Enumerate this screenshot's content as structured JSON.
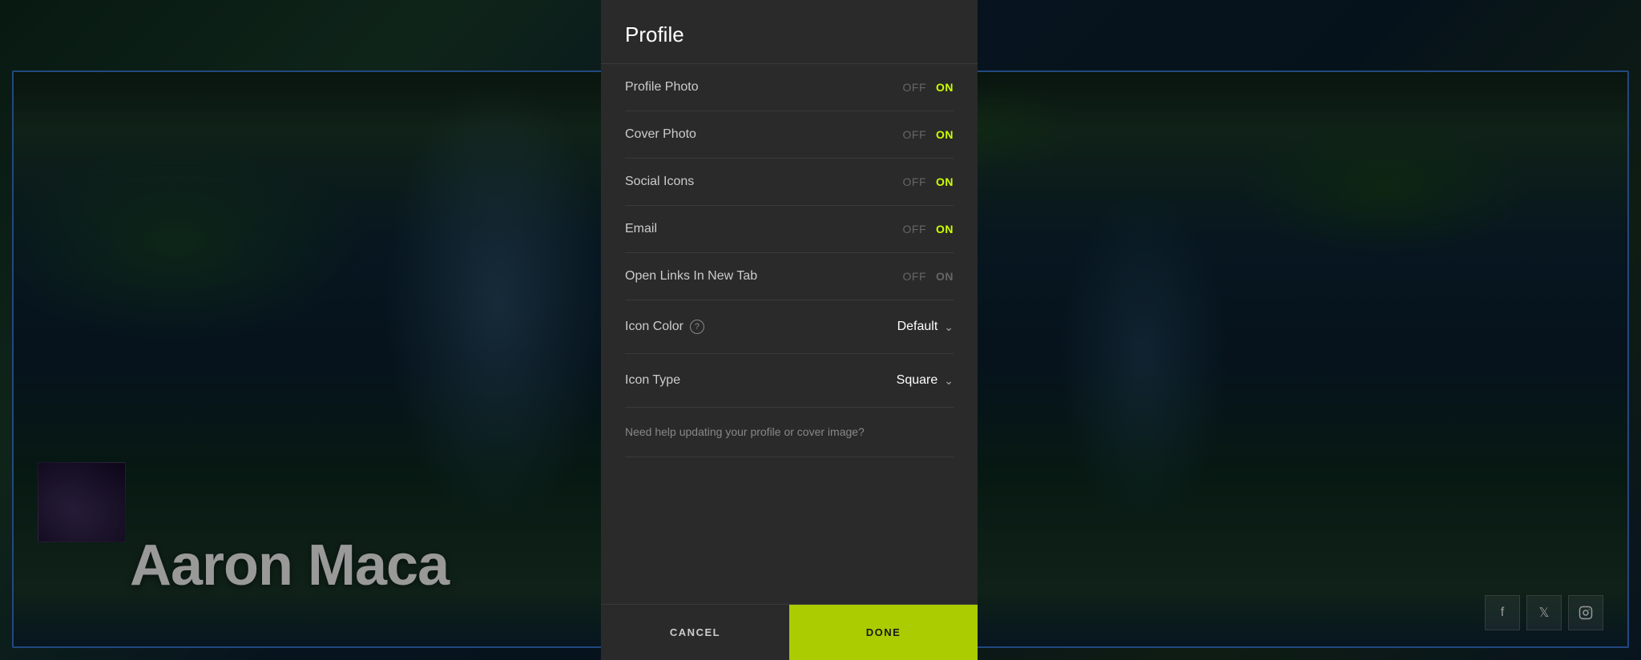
{
  "modal": {
    "title": "Profile",
    "settings": [
      {
        "id": "profile-photo",
        "label": "Profile Photo",
        "off_label": "OFF",
        "on_label": "ON",
        "value": true
      },
      {
        "id": "cover-photo",
        "label": "Cover Photo",
        "off_label": "OFF",
        "on_label": "ON",
        "value": true
      },
      {
        "id": "social-icons",
        "label": "Social Icons",
        "off_label": "OFF",
        "on_label": "ON",
        "value": true
      },
      {
        "id": "email",
        "label": "Email",
        "off_label": "OFF",
        "on_label": "ON",
        "value": true
      },
      {
        "id": "open-links",
        "label": "Open Links In New Tab",
        "off_label": "OFF",
        "on_label": "ON",
        "value": false
      }
    ],
    "icon_color": {
      "label": "Icon Color",
      "value": "Default",
      "has_help": true
    },
    "icon_type": {
      "label": "Icon Type",
      "value": "Square",
      "has_help": false
    },
    "help_text": "Need help updating your profile or cover image?",
    "cancel_label": "CANCEL",
    "done_label": "DONE"
  },
  "background": {
    "name": "Aaron Maca",
    "social_icons": [
      "f",
      "t",
      "ig"
    ]
  }
}
